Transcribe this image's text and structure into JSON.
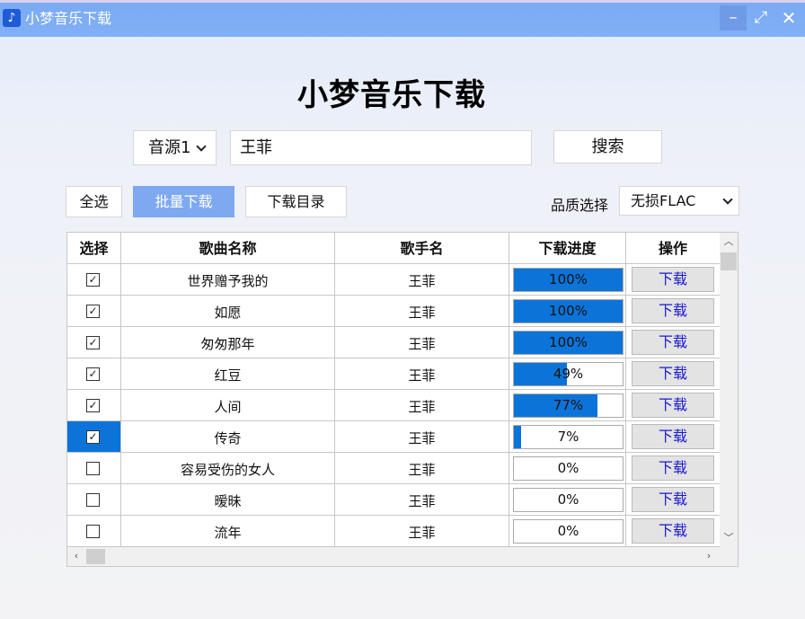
{
  "window": {
    "title": "小梦音乐下载",
    "minimize_glyph": "–",
    "maximize_glyph": "⤢",
    "close_glyph": "✕"
  },
  "heading": "小梦音乐下载",
  "search": {
    "source_value": "音源1",
    "query": "王菲",
    "button_label": "搜索"
  },
  "toolbar": {
    "select_all_label": "全选",
    "batch_download_label": "批量下载",
    "download_dir_label": "下载目录",
    "quality_label": "品质选择",
    "quality_value": "无损FLAC"
  },
  "table": {
    "headers": [
      "选择",
      "歌曲名称",
      "歌手名",
      "下载进度",
      "操作"
    ],
    "rows": [
      {
        "checked": true,
        "song": "世界赠予我的",
        "artist": "王菲",
        "progress": 100,
        "progress_text": "100%",
        "action": "下载"
      },
      {
        "checked": true,
        "song": "如愿",
        "artist": "王菲",
        "progress": 100,
        "progress_text": "100%",
        "action": "下载"
      },
      {
        "checked": true,
        "song": "匆匆那年",
        "artist": "王菲",
        "progress": 100,
        "progress_text": "100%",
        "action": "下载"
      },
      {
        "checked": true,
        "song": "红豆",
        "artist": "王菲",
        "progress": 49,
        "progress_text": "49%",
        "action": "下载"
      },
      {
        "checked": true,
        "song": "人间",
        "artist": "王菲",
        "progress": 77,
        "progress_text": "77%",
        "action": "下载"
      },
      {
        "checked": true,
        "selected": true,
        "song": "传奇",
        "artist": "王菲",
        "progress": 7,
        "progress_text": "7%",
        "action": "下载"
      },
      {
        "checked": false,
        "song": "容易受伤的女人",
        "artist": "王菲",
        "progress": 0,
        "progress_text": "0%",
        "action": "下载"
      },
      {
        "checked": false,
        "song": "暧昧",
        "artist": "王菲",
        "progress": 0,
        "progress_text": "0%",
        "action": "下载"
      },
      {
        "checked": false,
        "song": "流年",
        "artist": "王菲",
        "progress": 0,
        "progress_text": "0%",
        "action": "下载"
      }
    ]
  },
  "colors": {
    "accent": "#0c74d8",
    "titlebar": "#7aaaf2",
    "batch_button": "#7ea9f1",
    "download_link": "#1a1ad0"
  },
  "icons": {
    "app": "music-note-icon",
    "source_dropdown": "chevron-down-icon",
    "quality_dropdown": "chevron-down-icon"
  }
}
